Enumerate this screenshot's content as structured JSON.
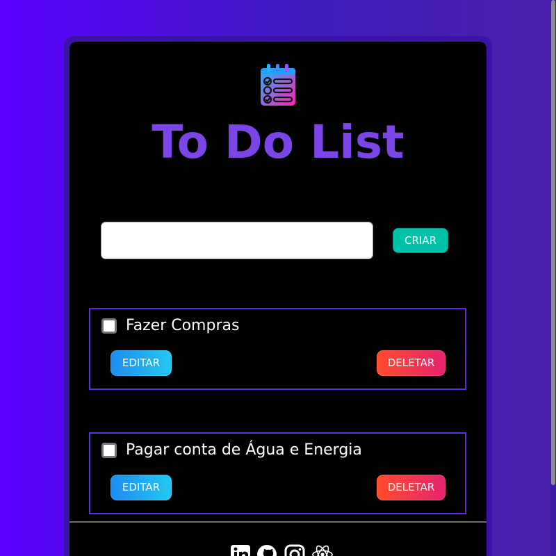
{
  "app": {
    "title": "To Do List",
    "logo_icon": "checklist-calendar-icon"
  },
  "form": {
    "input_value": "",
    "input_placeholder": "",
    "create_label": "CRIAR"
  },
  "tasks": [
    {
      "text": "Fazer Compras",
      "checked": false,
      "edit_label": "EDITAR",
      "delete_label": "DELETAR"
    },
    {
      "text": "Pagar conta de Água e Energia",
      "checked": false,
      "edit_label": "EDITAR",
      "delete_label": "DELETAR"
    }
  ],
  "footer": {
    "social_icons": [
      "linkedin-icon",
      "github-icon",
      "instagram-icon",
      "react-icon"
    ]
  },
  "colors": {
    "background_start": "#5a00ff",
    "background_end": "#4a1fa8",
    "title": "#7b45e8",
    "create_button": "#00c2a8",
    "edit_button": "#23c8ef",
    "delete_button": "#e7246e",
    "task_border": "#5b2fe0"
  }
}
